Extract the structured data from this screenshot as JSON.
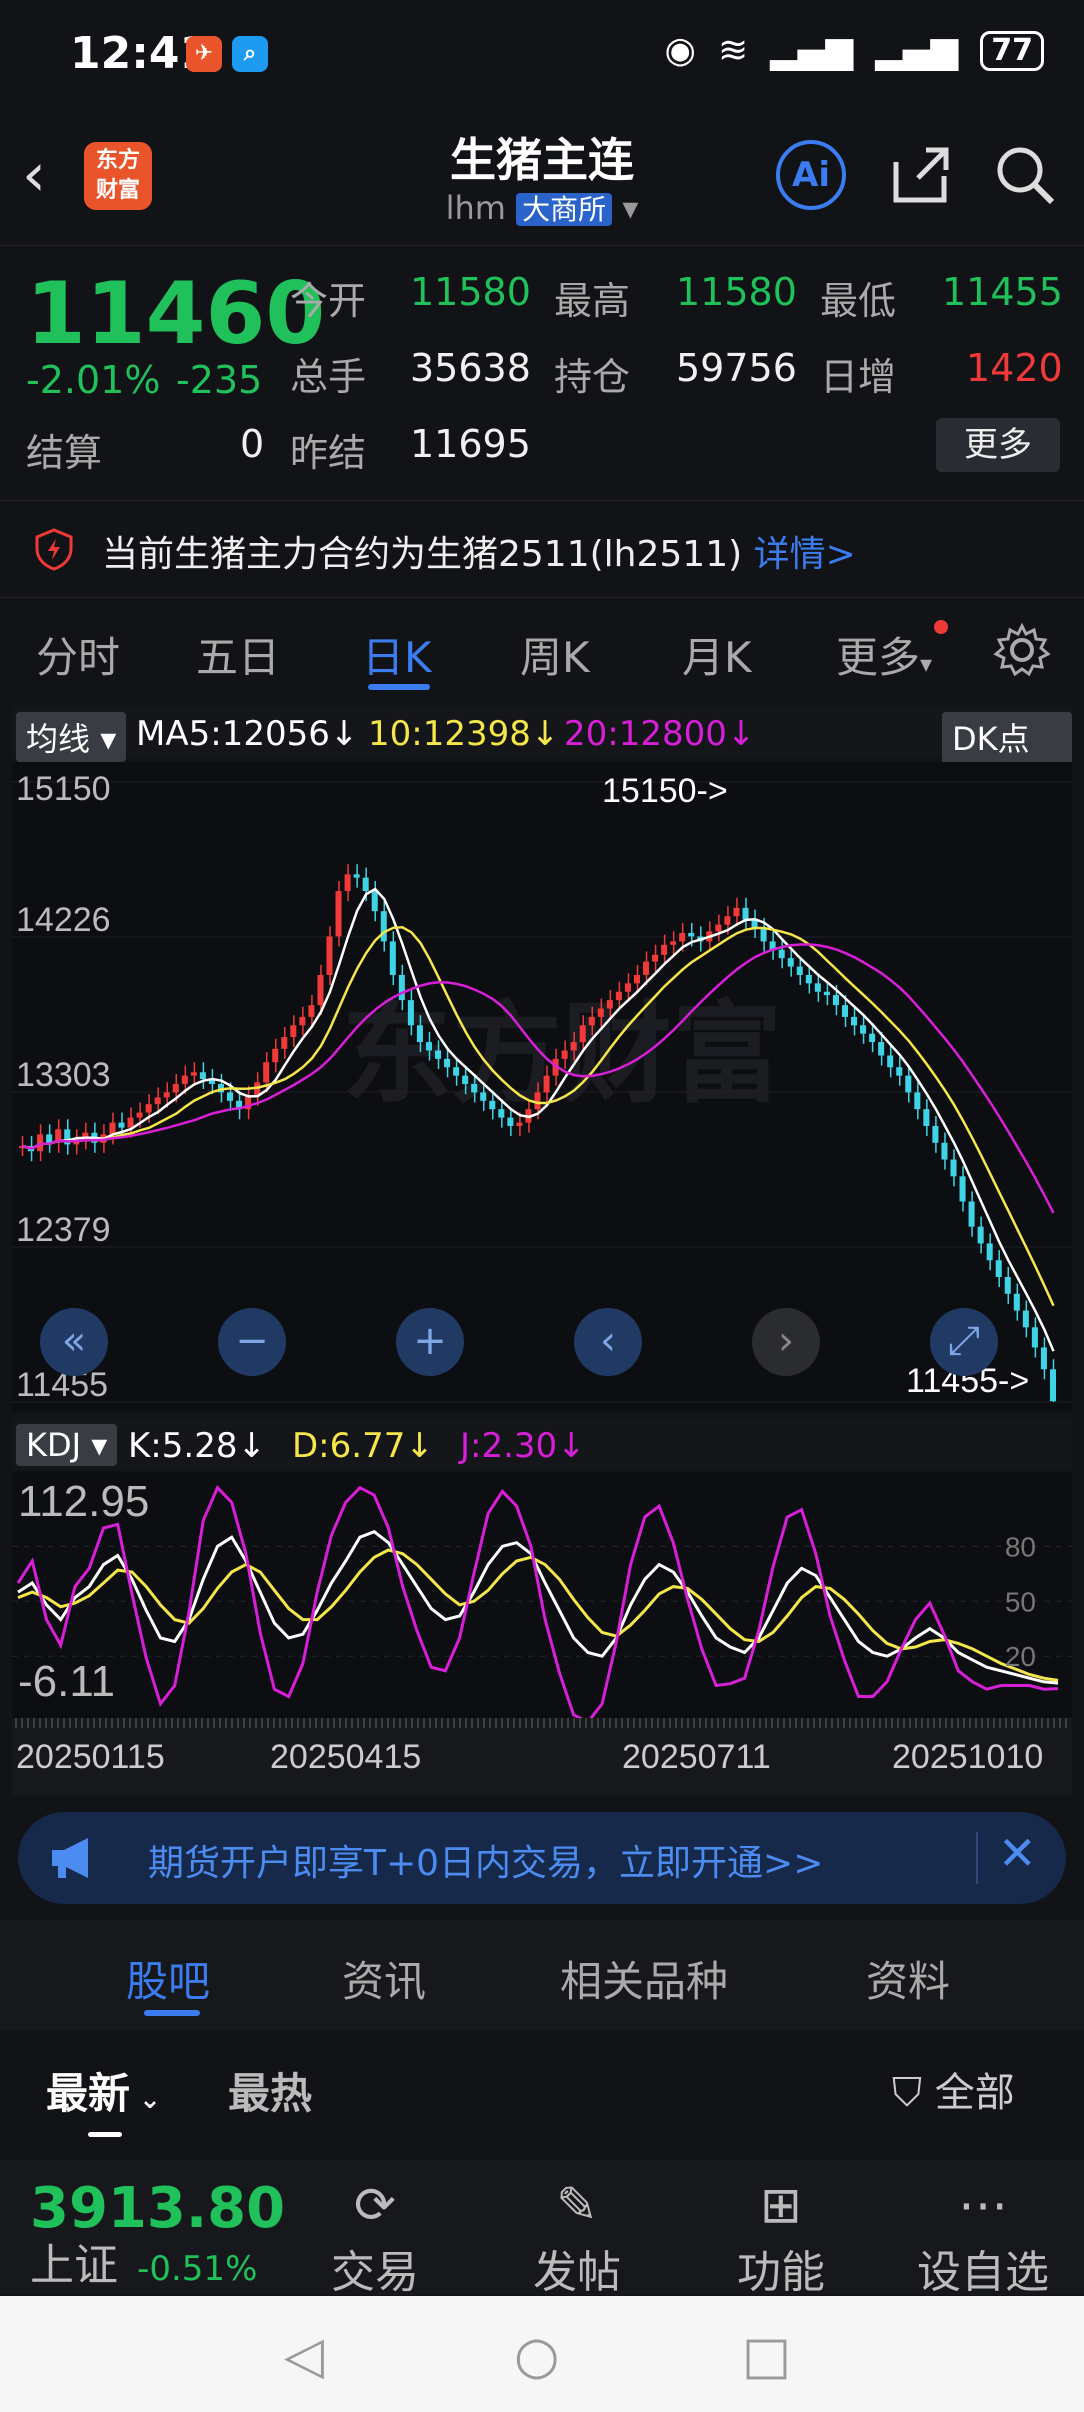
{
  "status": {
    "time": "12:41",
    "battery": "77"
  },
  "header": {
    "title": "生猪主连",
    "code": "lhm",
    "exchange": "大商所",
    "logo_line1": "东方",
    "logo_line2": "财富",
    "ai_label": "Ai"
  },
  "quote": {
    "price": "11460",
    "change_pct": "-2.01%",
    "change": "-235",
    "open_label": "今开",
    "open": "11580",
    "high_label": "最高",
    "high": "11580",
    "low_label": "最低",
    "low": "11455",
    "volume_label": "总手",
    "volume": "35638",
    "oi_label": "持仓",
    "oi": "59756",
    "daily_inc_label": "日增",
    "daily_inc": "1420",
    "settle_label": "结算",
    "settle": "0",
    "prev_settle_label": "昨结",
    "prev_settle": "11695",
    "more_label": "更多"
  },
  "notice": {
    "text": "当前生猪主力合约为生猪2511(lh2511)",
    "link": "详情>"
  },
  "chart_tabs": [
    "分时",
    "五日",
    "日K",
    "周K",
    "月K",
    "更多"
  ],
  "chart_tab_active": 2,
  "ma_legend": {
    "selector": "均线",
    "ma5": "MA5:12056↓",
    "ma10": "10:12398↓",
    "ma20": "20:12800↓",
    "dk": "DK点"
  },
  "kdj_legend": {
    "selector": "KDJ",
    "k": "K:5.28↓",
    "d": "D:6.77↓",
    "j": "J:2.30↓"
  },
  "colors": {
    "up": "#f03a3a",
    "down": "#20c05a",
    "accent": "#3b7cf0",
    "ma5": "#ffffff",
    "ma10": "#f5e64a",
    "ma20": "#d81fd8"
  },
  "chart_data": [
    {
      "type": "candlestick",
      "y_ticks": [
        "15150",
        "14226",
        "13303",
        "12379",
        "11455"
      ],
      "ylim": [
        11455,
        15150
      ],
      "max_label": "15150->",
      "min_label": "11455->",
      "x_ticks": [
        "20250115",
        "20250415",
        "20250711",
        "20251010"
      ],
      "close_approx": [
        12980,
        12950,
        13050,
        13000,
        13080,
        12990,
        13020,
        13060,
        13000,
        13050,
        13120,
        13090,
        13150,
        13180,
        13230,
        13270,
        13300,
        13350,
        13400,
        13420,
        13380,
        13350,
        13300,
        13250,
        13200,
        13280,
        13360,
        13480,
        13560,
        13630,
        13700,
        13750,
        13820,
        14000,
        14230,
        14500,
        14600,
        14580,
        14500,
        14380,
        14200,
        14000,
        13850,
        13700,
        13600,
        13550,
        13500,
        13450,
        13400,
        13350,
        13300,
        13250,
        13200,
        13150,
        13100,
        13120,
        13200,
        13300,
        13400,
        13500,
        13550,
        13600,
        13700,
        13750,
        13800,
        13850,
        13900,
        13950,
        14000,
        14080,
        14120,
        14180,
        14200,
        14250,
        14230,
        14200,
        14260,
        14300,
        14350,
        14400,
        14330,
        14280,
        14200,
        14150,
        14100,
        14050,
        14000,
        13950,
        13900,
        13880,
        13820,
        13750,
        13700,
        13650,
        13600,
        13520,
        13450,
        13400,
        13300,
        13200,
        13100,
        13000,
        12900,
        12800,
        12650,
        12500,
        12400,
        12300,
        12200,
        12100,
        12000,
        11900,
        11780,
        11650,
        11460
      ],
      "ma5_last": 12056,
      "ma10_last": 12398,
      "ma20_last": 12800
    },
    {
      "type": "line",
      "name": "KDJ",
      "y_ticks": [
        "112.95",
        "-6.11"
      ],
      "ylim": [
        -6.11,
        112.95
      ],
      "right_ticks": [
        "80",
        "50",
        "20"
      ],
      "series": [
        {
          "name": "K",
          "values": [
            55,
            60,
            48,
            40,
            52,
            58,
            70,
            75,
            62,
            45,
            30,
            28,
            40,
            62,
            80,
            85,
            72,
            55,
            38,
            30,
            32,
            45,
            60,
            72,
            85,
            88,
            82,
            70,
            58,
            46,
            40,
            42,
            55,
            70,
            80,
            82,
            76,
            60,
            45,
            30,
            22,
            20,
            30,
            48,
            62,
            70,
            66,
            55,
            42,
            30,
            25,
            22,
            30,
            45,
            60,
            68,
            64,
            52,
            40,
            28,
            22,
            20,
            24,
            30,
            35,
            30,
            22,
            18,
            14,
            12,
            10,
            8,
            6,
            5.28
          ]
        },
        {
          "name": "D",
          "values": [
            52,
            55,
            52,
            47,
            49,
            53,
            60,
            67,
            66,
            58,
            48,
            40,
            38,
            46,
            57,
            66,
            70,
            66,
            56,
            46,
            40,
            40,
            47,
            56,
            66,
            74,
            78,
            76,
            70,
            62,
            54,
            48,
            50,
            56,
            65,
            72,
            74,
            70,
            62,
            51,
            41,
            33,
            31,
            37,
            45,
            54,
            58,
            57,
            51,
            43,
            35,
            29,
            28,
            33,
            42,
            52,
            58,
            57,
            51,
            43,
            34,
            27,
            24,
            25,
            28,
            29,
            27,
            24,
            20,
            16,
            13,
            10,
            8,
            6.77
          ]
        },
        {
          "name": "J",
          "values": [
            60,
            72,
            40,
            26,
            58,
            68,
            90,
            92,
            54,
            19,
            -6,
            4,
            44,
            94,
            112,
            104,
            76,
            33,
            2,
            -2,
            16,
            55,
            86,
            104,
            112,
            108,
            90,
            58,
            34,
            14,
            12,
            30,
            65,
            98,
            110,
            102,
            80,
            40,
            11,
            -12,
            -16,
            -6,
            28,
            70,
            96,
            102,
            82,
            51,
            24,
            4,
            5,
            8,
            34,
            69,
            96,
            100,
            76,
            42,
            18,
            -2,
            -2,
            6,
            24,
            40,
            49,
            32,
            12,
            6,
            2,
            4,
            4,
            4,
            2,
            2.3
          ]
        }
      ]
    }
  ],
  "chart_controls": [
    "«",
    "−",
    "+",
    "‹",
    "›",
    "⤢"
  ],
  "banner": {
    "text": "期货开户即享T+0日内交易，立即开通>>"
  },
  "bottom_tabs": [
    "股吧",
    "资讯",
    "相关品种",
    "资料"
  ],
  "bottom_tab_active": 0,
  "sub_tabs": {
    "latest": "最新",
    "hot": "最热",
    "filter": "全部"
  },
  "index": {
    "value": "3913.80",
    "name": "上证",
    "change": "-0.51%"
  },
  "nav": [
    {
      "icon": "trade-icon",
      "label": "交易"
    },
    {
      "icon": "post-icon",
      "label": "发帖"
    },
    {
      "icon": "function-icon",
      "label": "功能"
    },
    {
      "icon": "watchlist-icon",
      "label": "设自选"
    }
  ]
}
